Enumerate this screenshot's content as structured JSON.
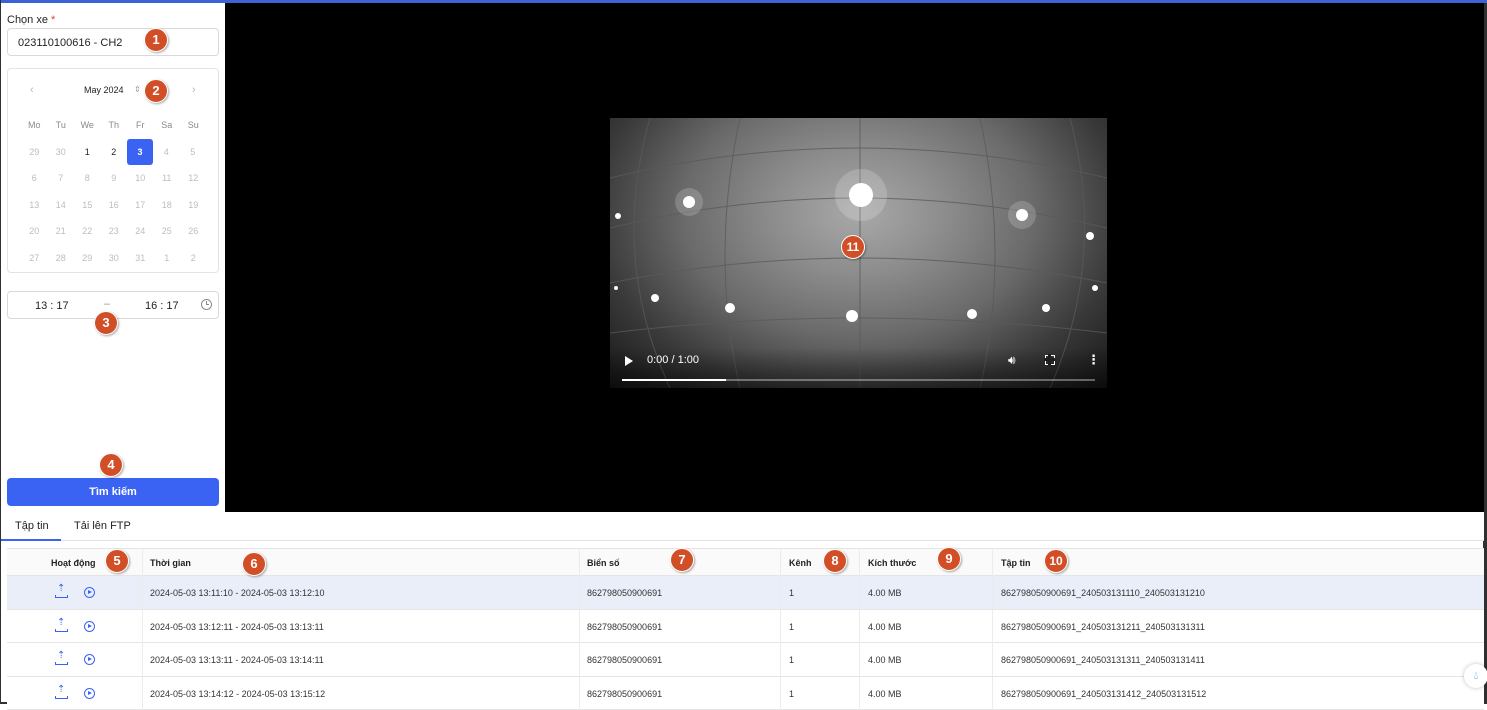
{
  "form": {
    "vehicle_label": "Chọn xe",
    "required_mark": "*",
    "vehicle_value": "023110100616 - CH2"
  },
  "calendar": {
    "month": "May 2024",
    "weekdays": [
      "Mo",
      "Tu",
      "We",
      "Th",
      "Fr",
      "Sa",
      "Su"
    ],
    "weeks": [
      [
        "29",
        "30",
        "1",
        "2",
        "3",
        "4",
        "5"
      ],
      [
        "6",
        "7",
        "8",
        "9",
        "10",
        "11",
        "12"
      ],
      [
        "13",
        "14",
        "15",
        "16",
        "17",
        "18",
        "19"
      ],
      [
        "20",
        "21",
        "22",
        "23",
        "24",
        "25",
        "26"
      ],
      [
        "27",
        "28",
        "29",
        "30",
        "31",
        "1",
        "2"
      ]
    ],
    "selected_day": "3"
  },
  "time_range": {
    "start": "13 : 17",
    "separator": "–",
    "end": "16 : 17"
  },
  "search_button": "Tìm kiếm",
  "video": {
    "time": "0:00 / 1:00",
    "progress": 0.22
  },
  "tabs": [
    "Tập tin",
    "Tải lên FTP"
  ],
  "table": {
    "columns": [
      "Hoạt động",
      "Thời gian",
      "Biển số",
      "Kênh",
      "Kích thước",
      "Tập tin"
    ],
    "rows": [
      {
        "time": "2024-05-03 13:11:10 - 2024-05-03 13:12:10",
        "plate": "862798050900691",
        "channel": "1",
        "size": "4.00 MB",
        "file": "862798050900691_240503131110_240503131210"
      },
      {
        "time": "2024-05-03 13:12:11 - 2024-05-03 13:13:11",
        "plate": "862798050900691",
        "channel": "1",
        "size": "4.00 MB",
        "file": "862798050900691_240503131211_240503131311"
      },
      {
        "time": "2024-05-03 13:13:11 - 2024-05-03 13:14:11",
        "plate": "862798050900691",
        "channel": "1",
        "size": "4.00 MB",
        "file": "862798050900691_240503131311_240503131411"
      },
      {
        "time": "2024-05-03 13:14:12 - 2024-05-03 13:15:12",
        "plate": "862798050900691",
        "channel": "1",
        "size": "4.00 MB",
        "file": "862798050900691_240503131412_240503131512"
      }
    ]
  },
  "markers": [
    "1",
    "2",
    "3",
    "4",
    "5",
    "6",
    "7",
    "8",
    "9",
    "10",
    "11"
  ],
  "colors": {
    "accent": "#3b63f3",
    "marker": "#d24e26",
    "selected_row": "#e9eef8"
  }
}
